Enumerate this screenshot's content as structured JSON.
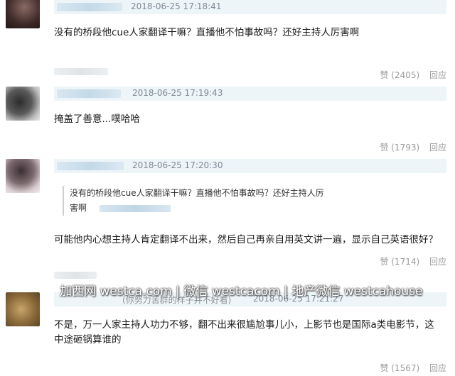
{
  "comments": [
    {
      "timestamp": "2018-06-25 17:18:41",
      "text": "没有的桥段他cue人家翻译干嘛？直播他不怕事故吗？还好主持人厉害啊",
      "likes": "赞 (2405)",
      "reply": "回应"
    },
    {
      "timestamp": "2018-06-25 17:19:43",
      "text": "掩盖了善意...噗哈哈",
      "likes": "赞 (1793)",
      "reply": "回应"
    },
    {
      "timestamp": "2018-06-25 17:20:30",
      "quote_line1": "没有的桥段他cue人家翻译干嘛？直播他不怕事故吗？还好主持人厉",
      "quote_line2": "害啊",
      "text": "可能他内心想主持人肯定翻译不出来，然后自己再亲自用英文讲一遍，显示自己英语很好？",
      "likes": "赞 (1714)",
      "reply": "回应"
    },
    {
      "name_suffix": "(你努力苦群的样子并不好看)",
      "timestamp": "2018-06-25 17:21:27",
      "text_line1": "不是，万一人家主持人功力不够，翻不出来很尴尬事儿小，上影节也是国际a类电影节，这",
      "text_line2": "中途砸锅算谁的",
      "likes": "赞 (1567)",
      "reply": "回应"
    }
  ],
  "watermark": "加西网 westca.com | 微信 westcacom | 地产微信 westcahouse"
}
